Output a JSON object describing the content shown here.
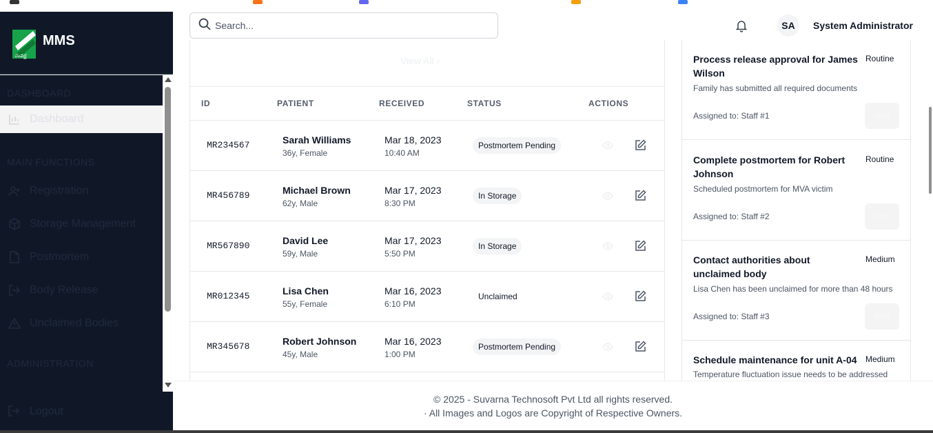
{
  "app": {
    "title": "MMS"
  },
  "sidebar": {
    "sections": {
      "dashboard": "DASHBOARD",
      "main": "MAIN FUNCTIONS",
      "admin": "ADMINISTRATION"
    },
    "items": [
      {
        "label": "Dashboard",
        "icon": "bar-chart-icon"
      },
      {
        "label": "Registration",
        "icon": "user-plus-icon"
      },
      {
        "label": "Storage Management",
        "icon": "box-icon"
      },
      {
        "label": "Postmortem",
        "icon": "file-icon"
      },
      {
        "label": "Body Release",
        "icon": "log-out-icon"
      },
      {
        "label": "Unclaimed Bodies",
        "icon": "alert-triangle-icon"
      }
    ],
    "logout": "Logout"
  },
  "header": {
    "search_placeholder": "Search...",
    "avatar_initials": "SA",
    "user_name": "System Administrator"
  },
  "records": {
    "view_all": "View All",
    "columns": [
      "ID",
      "PATIENT",
      "RECEIVED",
      "STATUS",
      "ACTIONS"
    ],
    "rows": [
      {
        "id": "MR234567",
        "name": "Sarah Williams",
        "details": "36y, Female",
        "date": "Mar 18, 2023",
        "time": "10:40 AM",
        "status": "Postmortem Pending"
      },
      {
        "id": "MR456789",
        "name": "Michael Brown",
        "details": "62y, Male",
        "date": "Mar 17, 2023",
        "time": "8:30 PM",
        "status": "In Storage"
      },
      {
        "id": "MR567890",
        "name": "David Lee",
        "details": "59y, Male",
        "date": "Mar 17, 2023",
        "time": "5:50 PM",
        "status": "In Storage"
      },
      {
        "id": "MR012345",
        "name": "Lisa Chen",
        "details": "55y, Female",
        "date": "Mar 16, 2023",
        "time": "6:10 PM",
        "status": "Unclaimed"
      },
      {
        "id": "MR345678",
        "name": "Robert Johnson",
        "details": "45y, Male",
        "date": "Mar 16, 2023",
        "time": "1:00 PM",
        "status": "Postmortem Pending"
      }
    ]
  },
  "tasks": [
    {
      "title": "Process release approval for James Wilson",
      "priority": "Routine",
      "description": "Family has submitted all required documents",
      "assigned": "Assigned to: Staff #1",
      "button": "Start"
    },
    {
      "title": "Complete postmortem for Robert Johnson",
      "priority": "Routine",
      "description": "Scheduled postmortem for MVA victim",
      "assigned": "Assigned to: Staff #2",
      "button": "Start"
    },
    {
      "title": "Contact authorities about unclaimed body",
      "priority": "Medium",
      "description": "Lisa Chen has been unclaimed for more than 48 hours",
      "assigned": "Assigned to: Staff #3",
      "button": "Start"
    },
    {
      "title": "Schedule maintenance for unit A-04",
      "priority": "Medium",
      "description": "Temperature fluctuation issue needs to be addressed",
      "assigned": "",
      "button": ""
    }
  ],
  "footer": {
    "line1": "© 2025 - Suvarna Technosoft Pvt Ltd all rights reserved.",
    "line2": "· All Images and Logos are Copyright of Respective Owners."
  },
  "colors": {
    "sidebar_bg": "#101828",
    "brand_green": "#16a34a",
    "badge_bg": "#f3f4f6"
  }
}
